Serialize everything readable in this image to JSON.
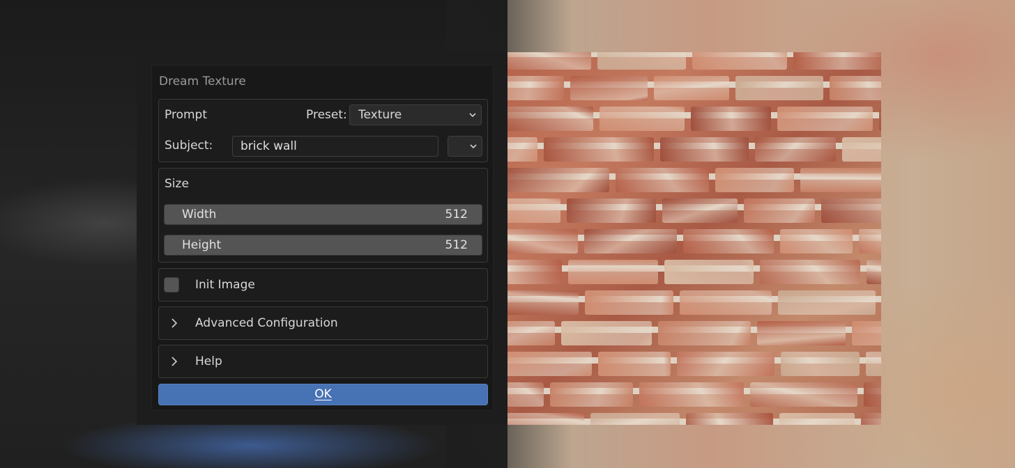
{
  "dialog": {
    "title": "Dream Texture",
    "prompt": {
      "label": "Prompt",
      "preset_label": "Preset:",
      "preset_value": "Texture",
      "subject_label": "Subject:",
      "subject_value": "brick wall"
    },
    "size": {
      "label": "Size",
      "width_label": "Width",
      "width_value": "512",
      "height_label": "Height",
      "height_value": "512"
    },
    "init_image": {
      "label": "Init Image",
      "checked": false
    },
    "advanced": {
      "label": "Advanced Configuration",
      "expanded": false
    },
    "help": {
      "label": "Help",
      "expanded": false
    },
    "ok_label": "OK"
  },
  "colors": {
    "accent": "#4772b3",
    "panel_bg": "#181818",
    "slider_bg": "#545454"
  },
  "icons": {
    "dropdown": "chevron-down-icon",
    "collapsed": "chevron-right-icon"
  }
}
